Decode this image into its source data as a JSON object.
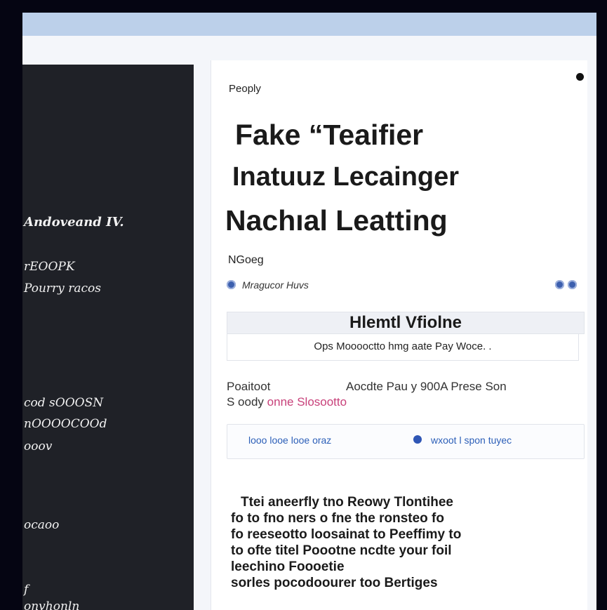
{
  "sidebar": {
    "heading": "Andoveand IV.",
    "items": [
      "rEOOPK",
      "Pourry racos",
      "cod sOOOSN",
      "nOOOOCOOd",
      "ooov",
      "ocaoo",
      "f",
      "onvhonln"
    ]
  },
  "content": {
    "breadcrumb": "Peoply",
    "title_lines": [
      "Fake  “Teaifier",
      "Inatuuz Lecainger",
      "Nachıal Leatting"
    ],
    "subtitle": "NGoeg",
    "message_label": "Mragucor Huvs",
    "widget": {
      "header": "Hlemtl Vfiolne",
      "line": "Ops Mooooctto hmg aate Pay Woce. .",
      "field_left": "Poaitoot",
      "field_right": "Aocdte Pau y 900A Prese Son",
      "field_line2_prefix": "S oody ",
      "field_line2_highlight": "onne Slosootto"
    },
    "links": {
      "left": "looo looe looe oraz",
      "right": "wxoot l spon tuyec"
    },
    "body_lines": [
      "Ttei aneerfly tno Reowy Tlontihee",
      "fo to fno ners o fne the ronsteo fo",
      "fo reeseotto loosainat to Peeffimy to",
      "to ofte titel Poootne ncdte your foil",
      "leechino Foooetie",
      "sorles pocodoourer too Bertiges"
    ]
  },
  "colors": {
    "topbar": "#bcd0ea",
    "sidebar": "#1f2127",
    "accent_blue": "#2c5fb8",
    "accent_pink": "#c8417a"
  }
}
